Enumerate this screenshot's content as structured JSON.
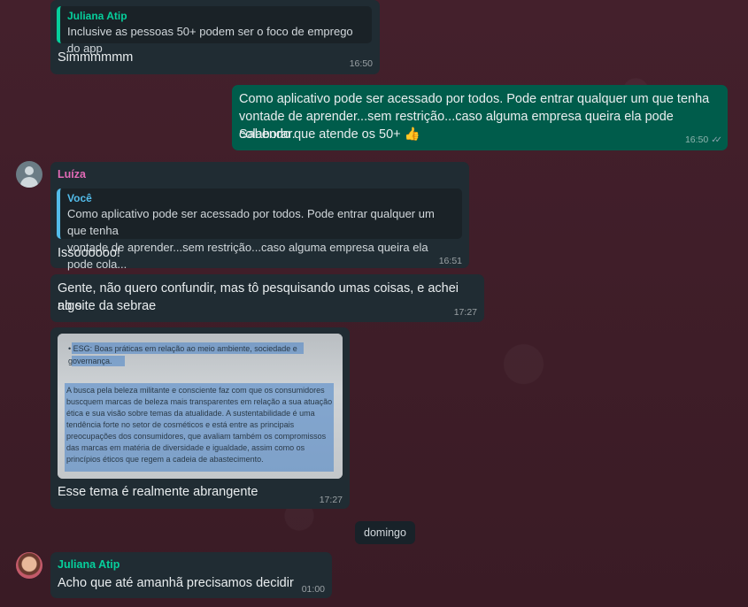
{
  "colors": {
    "incoming_bubble": "#202c33",
    "outgoing_bubble": "#005c4b",
    "sender_juliana": "#06cf9c",
    "sender_luiza": "#e26ab6",
    "quote_you": "#53bdeb"
  },
  "messages": [
    {
      "quote_name": "Juliana Atip",
      "quote_text": "Inclusive as pessoas 50+ podem ser o foco de emprego do app",
      "text": "Simmmmmm",
      "time": "16:50"
    },
    {
      "text_lines": [
        "Como aplicativo pode ser acessado por todos. Pode entrar qualquer um que tenha",
        "vontade de aprender...sem restrição...caso alguma empresa queira ela pode colaborar.",
        "Sabendo que atende os 50+ 👍"
      ],
      "time": "16:50"
    },
    {
      "sender": "Luíza",
      "quote_name": "Você",
      "quote_lines": [
        "Como aplicativo pode ser acessado por todos. Pode entrar qualquer um que tenha",
        "vontade de aprender...sem restrição...caso alguma empresa queira ela pode cola..."
      ],
      "text": "Issoooooo!",
      "time": "16:51"
    },
    {
      "text_lines": [
        "Gente, não quero confundir, mas tô pesquisando umas coisas, e achei algo",
        "no site da sebrae"
      ],
      "time": "17:27"
    },
    {
      "image_text": [
        "• ESG: Boas práticas em relação ao meio ambiente, sociedade e",
        "  governança.",
        "A busca pela beleza militante e consciente faz com que os consumidores",
        "buscquem marcas de beleza mais transparentes em relação a sua atuação",
        "ética e sua visão sobre temas da atualidade. A sustentabilidade é uma",
        "tendência forte no setor de cosméticos e está entre as principais",
        "preocupações dos consumidores, que avaliam também os compromissos",
        "das marcas em matéria de diversidade e igualdade, assim como os",
        "princípios éticos que regem a cadeia de abastecimento."
      ],
      "caption": "Esse tema é realmente abrangente",
      "time": "17:27"
    },
    {
      "sender": "Juliana Atip",
      "text": "Acho que até amanhã precisamos decidir",
      "time": "01:00"
    }
  ],
  "date_separator": "domingo"
}
